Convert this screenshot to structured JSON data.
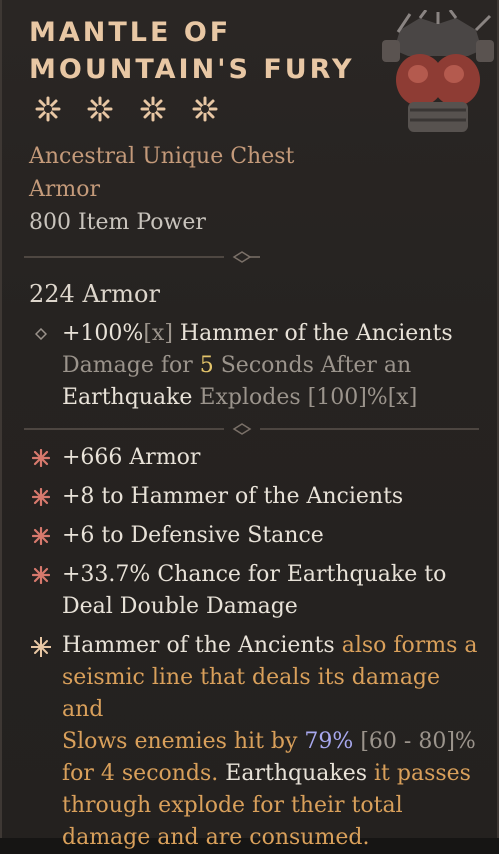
{
  "item": {
    "name": "Mantle of Mountain's Fury",
    "stars": 4,
    "subtype_line1": "Ancestral Unique Chest",
    "subtype_line2": "Armor",
    "item_power": "800 Item Power",
    "armor": "224 Armor"
  },
  "implicit": {
    "p1": "+100%",
    "p2": "[x]",
    "p3": " Hammer of the Ancients",
    "p4": "Damage for ",
    "p5": "5",
    "p6": " Seconds After an",
    "p7": "Earthquake",
    "p8": " Explodes ",
    "p9": "[100]%",
    "p10": "[x]"
  },
  "affixes": [
    {
      "text": "+666 Armor"
    },
    {
      "text": "+8 to Hammer of the Ancients"
    },
    {
      "text": "+6 to Defensive Stance"
    },
    {
      "line1": "+33.7% Chance for Earthquake to",
      "line2": "Deal Double Damage"
    }
  ],
  "unique": {
    "a": "Hammer of the Ancients",
    "b": " also forms a",
    "c": "seismic line that deals its damage and",
    "d": "Slows enemies hit by ",
    "e": "79%",
    "f": " [60 - 80]%",
    "g": "for 4 seconds. ",
    "h": "Earthquakes",
    "i": " it passes",
    "j": "through explode for their total",
    "k": "damage and are consumed."
  },
  "colors": {
    "title": "#e8c7a4",
    "subtype": "#c49a7a",
    "unique_text": "#d9a05b",
    "roll_value": "#a8a8ee"
  }
}
